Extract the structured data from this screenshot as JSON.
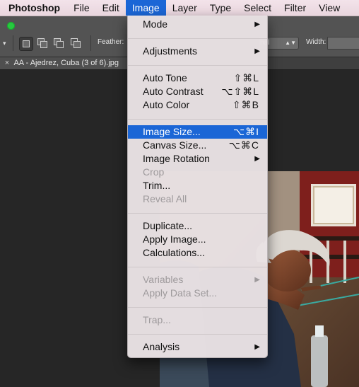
{
  "menubar": {
    "app_name": "Photoshop",
    "items": [
      "File",
      "Edit",
      "Image",
      "Layer",
      "Type",
      "Select",
      "Filter",
      "View"
    ],
    "active": "Image"
  },
  "options_bar": {
    "feather_label": "Feather:",
    "style_value": "nal",
    "width_label": "Width:"
  },
  "document_tab": {
    "close_glyph": "×",
    "title": "AA - Ajedrez, Cuba (3 of 6).jpg"
  },
  "image_menu": {
    "items": [
      {
        "label": "Mode",
        "shortcut": "",
        "submenu": true,
        "enabled": true
      },
      {
        "label": "Adjustments",
        "shortcut": "",
        "submenu": true,
        "enabled": true
      },
      {
        "label": "Auto Tone",
        "shortcut": "⇧⌘L",
        "submenu": false,
        "enabled": true
      },
      {
        "label": "Auto Contrast",
        "shortcut": "⌥⇧⌘L",
        "submenu": false,
        "enabled": true
      },
      {
        "label": "Auto Color",
        "shortcut": "⇧⌘B",
        "submenu": false,
        "enabled": true
      },
      {
        "label": "Image Size...",
        "shortcut": "⌥⌘I",
        "submenu": false,
        "enabled": true,
        "highlighted": true
      },
      {
        "label": "Canvas Size...",
        "shortcut": "⌥⌘C",
        "submenu": false,
        "enabled": true
      },
      {
        "label": "Image Rotation",
        "shortcut": "",
        "submenu": true,
        "enabled": true
      },
      {
        "label": "Crop",
        "shortcut": "",
        "submenu": false,
        "enabled": false
      },
      {
        "label": "Trim...",
        "shortcut": "",
        "submenu": false,
        "enabled": true
      },
      {
        "label": "Reveal All",
        "shortcut": "",
        "submenu": false,
        "enabled": false
      },
      {
        "label": "Duplicate...",
        "shortcut": "",
        "submenu": false,
        "enabled": true
      },
      {
        "label": "Apply Image...",
        "shortcut": "",
        "submenu": false,
        "enabled": true
      },
      {
        "label": "Calculations...",
        "shortcut": "",
        "submenu": false,
        "enabled": true
      },
      {
        "label": "Variables",
        "shortcut": "",
        "submenu": true,
        "enabled": false
      },
      {
        "label": "Apply Data Set...",
        "shortcut": "",
        "submenu": false,
        "enabled": false
      },
      {
        "label": "Trap...",
        "shortcut": "",
        "submenu": false,
        "enabled": false
      },
      {
        "label": "Analysis",
        "shortcut": "",
        "submenu": true,
        "enabled": true
      }
    ],
    "submenu_arrow": "▶"
  },
  "colors": {
    "accent": "#1b66d6",
    "menubar_bg": "#f0e0e7",
    "workspace_bg": "#262626"
  }
}
